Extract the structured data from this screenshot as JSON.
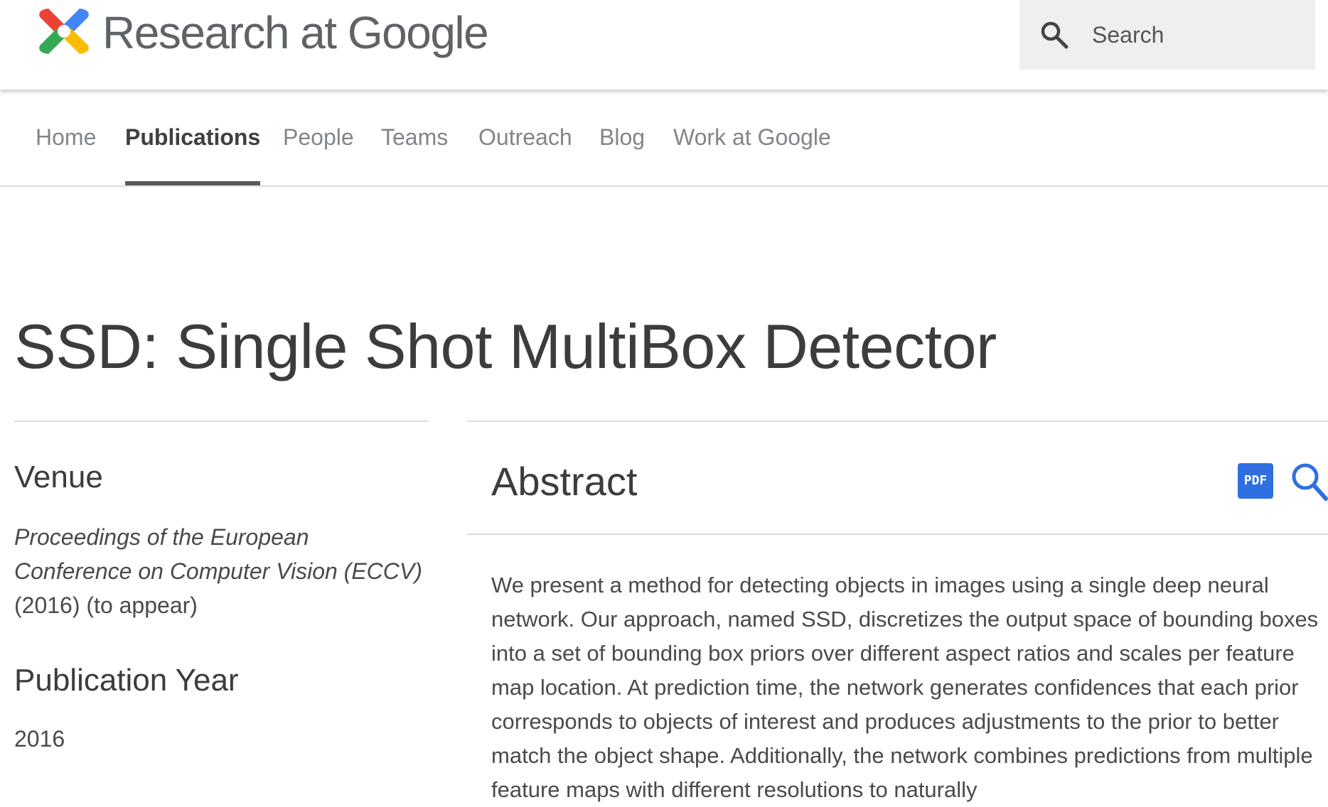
{
  "header": {
    "brand": "Research at Google",
    "logo_icon": "research-at-google-logo-icon",
    "search": {
      "icon": "search-icon",
      "label": "Search"
    }
  },
  "nav": {
    "items": [
      {
        "label": "Home",
        "active": false
      },
      {
        "label": "Publications",
        "active": true
      },
      {
        "label": "People",
        "active": false
      },
      {
        "label": "Teams",
        "active": false
      },
      {
        "label": "Outreach",
        "active": false
      },
      {
        "label": "Blog",
        "active": false
      },
      {
        "label": "Work at Google",
        "active": false
      }
    ]
  },
  "publication": {
    "title": "SSD: Single Shot MultiBox Detector",
    "venue_heading": "Venue",
    "venue_italic": "Proceedings of the European Conference on Computer Vision (ECCV)",
    "venue_suffix": " (2016) (to appear)",
    "year_heading": "Publication Year",
    "year": "2016",
    "abstract_heading": "Abstract",
    "pdf_label": "PDF",
    "abstract": "We present a method for detecting objects in images using a single deep neural network. Our approach, named SSD, discretizes the output space of bounding boxes into a set of bounding box priors over different aspect ratios and scales per feature map location. At prediction time, the network generates confidences that each prior corresponds to objects of interest and produces adjustments to the prior to better match the object shape. Additionally, the network combines predictions from multiple feature maps with different resolutions to naturally"
  },
  "colors": {
    "accent_blue": "#2f6fe0",
    "nav_active": "#3c4043",
    "nav_inactive": "#80868b",
    "search_bg": "#efefef"
  }
}
